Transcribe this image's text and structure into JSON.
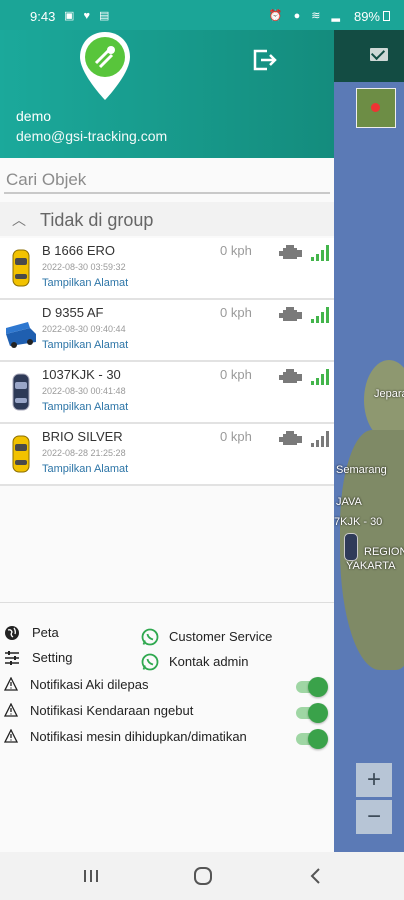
{
  "status_bar": {
    "time": "9:43",
    "battery": "89%"
  },
  "drawer": {
    "user": {
      "name": "demo",
      "email": "demo@gsi-tracking.com"
    },
    "search": {
      "placeholder": "Cari Objek"
    },
    "group": {
      "title": "Tidak di group"
    },
    "vehicles": [
      {
        "name": "B 1666 ERO",
        "datetime": "2022-08-30 03:59:32",
        "speed": "0 kph",
        "address_link": "Tampilkan Alamat",
        "vehicle_icon": "yellow-taxi-icon",
        "signal_color": "#43b54b"
      },
      {
        "name": "D 9355 AF",
        "datetime": "2022-08-30 09:40:44",
        "speed": "0 kph",
        "address_link": "Tampilkan Alamat",
        "vehicle_icon": "blue-truck-icon",
        "signal_color": "#43b54b"
      },
      {
        "name": "1037KJK - 30",
        "datetime": "2022-08-30 00:41:48",
        "speed": "0 kph",
        "address_link": "Tampilkan Alamat",
        "vehicle_icon": "dark-car-icon",
        "signal_color": "#43b54b"
      },
      {
        "name": "BRIO SILVER",
        "datetime": "2022-08-28 21:25:28",
        "speed": "0 kph",
        "address_link": "Tampilkan Alamat",
        "vehicle_icon": "yellow-taxi-icon",
        "signal_color": "#7a7a7a"
      }
    ],
    "menu": {
      "peta": "Peta",
      "setting": "Setting",
      "customer_service": "Customer Service",
      "kontak_admin": "Kontak admin"
    },
    "notifications": [
      {
        "label": "Notifikasi Aki dilepas",
        "enabled": true
      },
      {
        "label": "Notifikasi Kendaraan ngebut",
        "enabled": true
      },
      {
        "label": "Notifikasi mesin dihidupkan/dimatikan",
        "enabled": true
      }
    ]
  },
  "map": {
    "labels": [
      "Jepara",
      "Semarang",
      "JAVA",
      "7KJK - 30",
      "REGION",
      "YAKARTA"
    ],
    "zoom_in": "+",
    "zoom_out": "−"
  },
  "colors": {
    "accent": "#1ba597",
    "link": "#2d75a7",
    "toggle_on": "#3aa24a",
    "whatsapp": "#2fa84f"
  }
}
